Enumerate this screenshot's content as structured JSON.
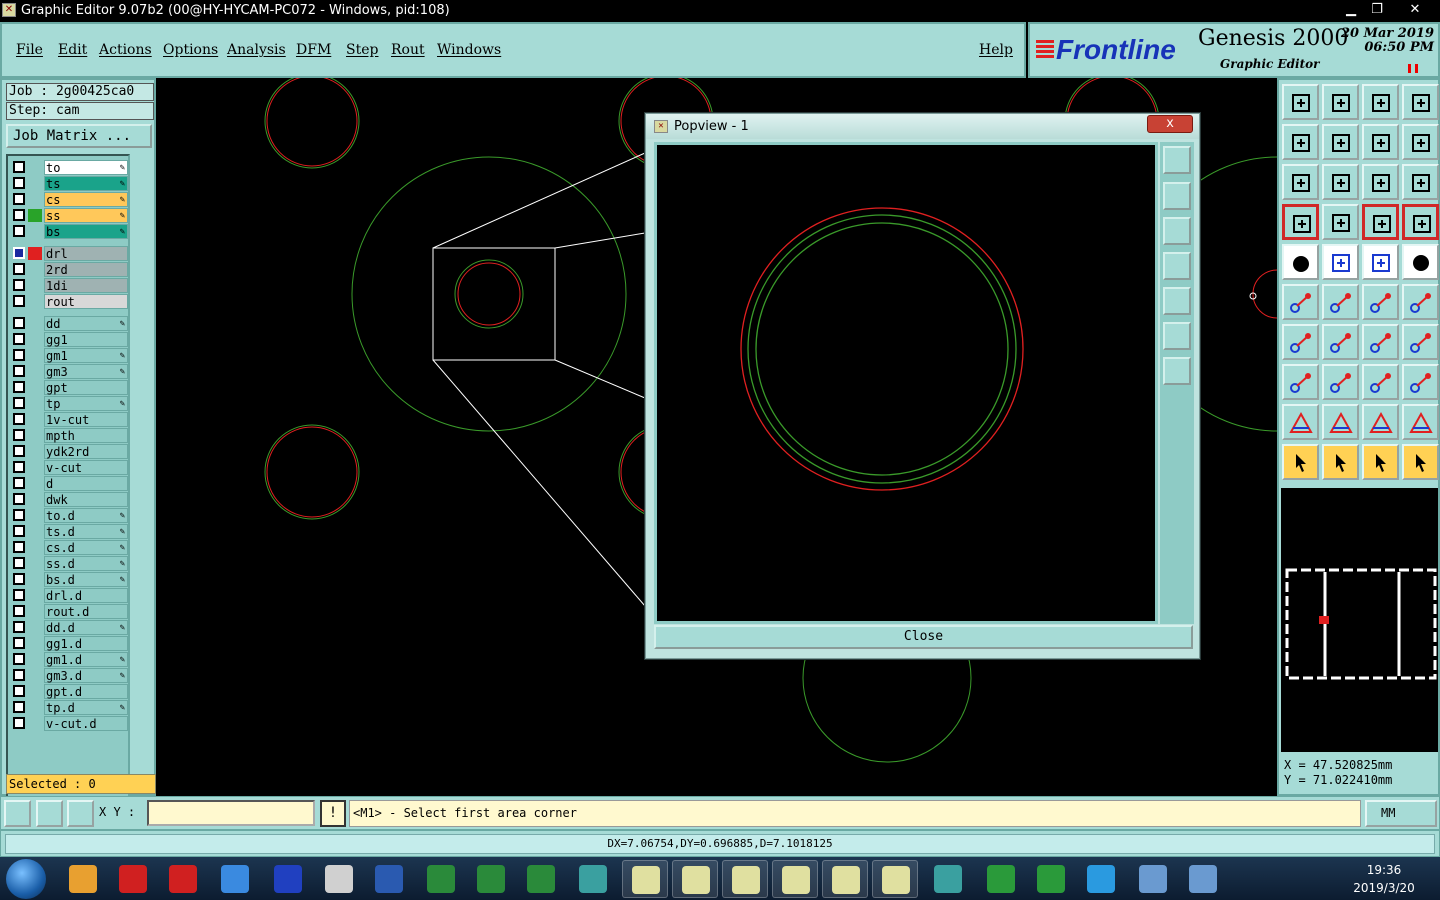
{
  "window": {
    "title": "Graphic Editor 9.07b2 (00@HY-HYCAM-PC072 - Windows, pid:108)"
  },
  "menu": {
    "items": [
      "File",
      "Edit",
      "Actions",
      "Options",
      "Analysis",
      "DFM",
      "Step",
      "Rout",
      "Windows"
    ],
    "help": "Help"
  },
  "brand": {
    "logo": "Frontline",
    "product": "Genesis 2000",
    "subtitle": "Graphic Editor",
    "date": "20 Mar 2019",
    "time": "06:50 PM"
  },
  "job": {
    "job_label": "Job : 2g00425ca0",
    "step_label": "Step: cam",
    "matrix_button": "Job Matrix ..."
  },
  "layers": [
    {
      "name": "to",
      "bg": "#ffffff",
      "affected": true
    },
    {
      "name": "ts",
      "bg": "#1aa38a",
      "affected": true
    },
    {
      "name": "cs",
      "bg": "#ffc85a",
      "affected": true
    },
    {
      "name": "ss",
      "bg": "#ffc85a",
      "affected": true,
      "color": "#29a329"
    },
    {
      "name": "bs",
      "bg": "#1aa38a",
      "affected": true
    },
    {
      "name": "drl",
      "bg": "#9fb2b2",
      "affected": false,
      "color": "#e02020",
      "active": true
    },
    {
      "name": "2rd",
      "bg": "#9fb2b2",
      "affected": false
    },
    {
      "name": "1di",
      "bg": "#9fb2b2",
      "affected": false
    },
    {
      "name": "rout",
      "bg": "#d8d8d8",
      "affected": false
    },
    {
      "name": "dd",
      "bg": "#8ecbc5",
      "affected": true
    },
    {
      "name": "gg1",
      "bg": "#8ecbc5",
      "affected": false
    },
    {
      "name": "gm1",
      "bg": "#8ecbc5",
      "affected": true
    },
    {
      "name": "gm3",
      "bg": "#8ecbc5",
      "affected": true
    },
    {
      "name": "gpt",
      "bg": "#8ecbc5",
      "affected": false
    },
    {
      "name": "tp",
      "bg": "#8ecbc5",
      "affected": true
    },
    {
      "name": "1v-cut",
      "bg": "#8ecbc5",
      "affected": false
    },
    {
      "name": "mpth",
      "bg": "#8ecbc5",
      "affected": false
    },
    {
      "name": "ydk2rd",
      "bg": "#8ecbc5",
      "affected": false
    },
    {
      "name": "v-cut",
      "bg": "#8ecbc5",
      "affected": false
    },
    {
      "name": "d",
      "bg": "#8ecbc5",
      "affected": false
    },
    {
      "name": "dwk",
      "bg": "#8ecbc5",
      "affected": false
    },
    {
      "name": "to.d",
      "bg": "#8ecbc5",
      "affected": true
    },
    {
      "name": "ts.d",
      "bg": "#8ecbc5",
      "affected": true
    },
    {
      "name": "cs.d",
      "bg": "#8ecbc5",
      "affected": true
    },
    {
      "name": "ss.d",
      "bg": "#8ecbc5",
      "affected": true
    },
    {
      "name": "bs.d",
      "bg": "#8ecbc5",
      "affected": true
    },
    {
      "name": "drl.d",
      "bg": "#8ecbc5",
      "affected": false
    },
    {
      "name": "rout.d",
      "bg": "#8ecbc5",
      "affected": false
    },
    {
      "name": "dd.d",
      "bg": "#8ecbc5",
      "affected": true
    },
    {
      "name": "gg1.d",
      "bg": "#8ecbc5",
      "affected": false
    },
    {
      "name": "gm1.d",
      "bg": "#8ecbc5",
      "affected": true
    },
    {
      "name": "gm3.d",
      "bg": "#8ecbc5",
      "affected": true
    },
    {
      "name": "gpt.d",
      "bg": "#8ecbc5",
      "affected": false
    },
    {
      "name": "tp.d",
      "bg": "#8ecbc5",
      "affected": true
    },
    {
      "name": "v-cut.d",
      "bg": "#8ecbc5",
      "affected": false
    }
  ],
  "selected": "Selected : 0",
  "popup": {
    "title": "Popview - 1",
    "close_label": "Close",
    "close_x": "x"
  },
  "coords": {
    "x": "X  =  47.520825mm",
    "y": "Y  =  71.022410mm"
  },
  "status": {
    "xy_label": "X Y :",
    "xy_value": "",
    "message": "<M1> - Select first area corner",
    "units": "MM",
    "excl": "!"
  },
  "measure": "DX=7.06754,DY=0.696885,D=7.1018125",
  "taskbar": {
    "time": "19:36",
    "date": "2019/3/20"
  },
  "colors": {
    "panel": "#a6dbd6",
    "drill_red": "#e02020",
    "outline_green": "#3a9a2a"
  }
}
